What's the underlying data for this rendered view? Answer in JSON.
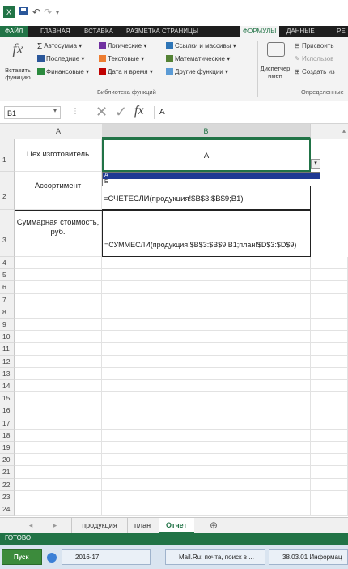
{
  "ribbon_tabs": [
    "ФАЙЛ",
    "ГЛАВНАЯ",
    "ВСТАВКА",
    "РАЗМЕТКА СТРАНИЦЫ",
    "ФОРМУЛЫ",
    "ДАННЫЕ",
    "РЕ"
  ],
  "ribbon": {
    "insert_function": "Вставить функцию",
    "library": [
      "Автосумма ▾",
      "Последние ▾",
      "Финансовые ▾",
      "Логические ▾",
      "Текстовые ▾",
      "Дата и время ▾",
      "Ссылки и массивы ▾",
      "Математические ▾",
      "Другие функции ▾"
    ],
    "library_group": "Библиотека функций",
    "name_manager": "Диспетчер имен",
    "names": [
      "Присвоить",
      "Использов",
      "Создать из"
    ],
    "names_group": "Определенные"
  },
  "formula_bar": {
    "name_box": "B1",
    "fx": "fx",
    "value": "A"
  },
  "columns": [
    "A",
    "B"
  ],
  "rows": [
    "1",
    "2",
    "3",
    "4",
    "5",
    "6",
    "7",
    "8",
    "9",
    "10",
    "11",
    "12",
    "13",
    "14",
    "15",
    "16",
    "17",
    "18",
    "19",
    "20",
    "21",
    "22",
    "23",
    "24"
  ],
  "cells": {
    "a1": "Цех изготовитель",
    "b1": "A",
    "a2": "Ассортимент",
    "b2": "=СЧЕТЕСЛИ(продукция!$B$3:$B$9;B1)",
    "a3": "Суммарная стоимость, руб.",
    "b3": "=СУММЕСЛИ(продукция!$B$3:$B$9;B1;план!$D$3:$D$9)"
  },
  "dropdown_options": [
    "A",
    "Б"
  ],
  "sheet_tabs": [
    "продукция",
    "план",
    "Отчет"
  ],
  "status": "ГОТОВО",
  "taskbar": {
    "start": "Пуск",
    "items": [
      "2016-17",
      "Mail.Ru: почта, поиск в ...",
      "38.03.01 Информац"
    ]
  },
  "colors": {
    "excel_green": "#217346",
    "selection": "#1f3a93"
  }
}
